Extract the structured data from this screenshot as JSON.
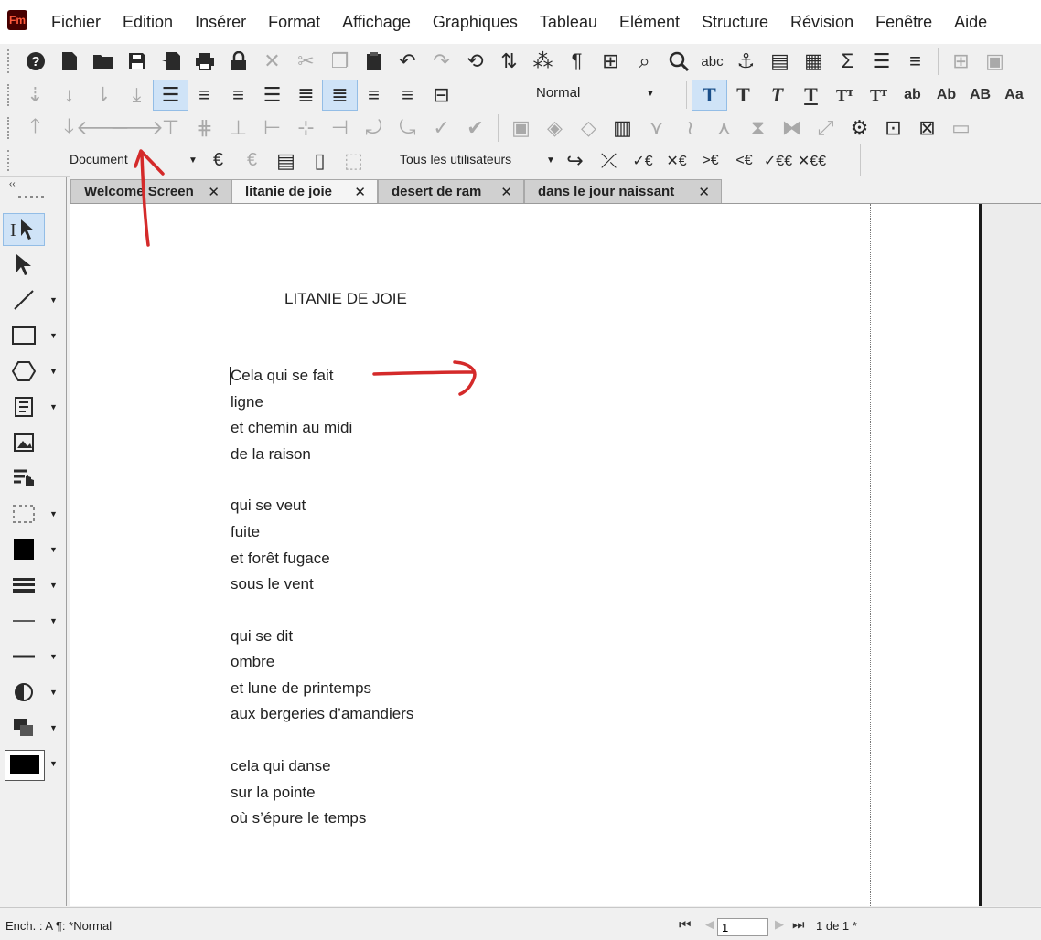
{
  "app": {
    "logo_text": "Fm"
  },
  "menu": [
    "Fichier",
    "Edition",
    "Insérer",
    "Format",
    "Affichage",
    "Graphiques",
    "Tableau",
    "Elément",
    "Structure",
    "Révision",
    "Fenêtre",
    "Aide"
  ],
  "toolbar": {
    "paragraph_style": "Normal",
    "text_styles": [
      "T",
      "T",
      "T",
      "T",
      "Tᵀ",
      "Tᵀ",
      "ab",
      "Ab",
      "AB",
      "Aa"
    ],
    "doc_scope": "Document",
    "user_filter": "Tous les utilisateurs"
  },
  "tabs": [
    {
      "label": "Welcome Screen",
      "close": "✕"
    },
    {
      "label": "litanie de joie",
      "close": "✕"
    },
    {
      "label": "desert de ram",
      "close": "✕"
    },
    {
      "label": "dans le jour naissant",
      "close": "✕"
    }
  ],
  "document": {
    "title": "LITANIE DE JOIE",
    "lines": [
      "Cela qui se fait",
      "ligne",
      "et chemin au midi",
      "de la raison",
      "qui se veut",
      "fuite",
      "et forêt fugace",
      "sous le vent",
      "qui se dit",
      "ombre",
      "et lune de printemps",
      "aux bergeries d’amandiers",
      "cela qui danse",
      "sur la pointe",
      "où s’épure le temps"
    ]
  },
  "status": {
    "text": "Ench. : A  ¶: *Normal",
    "page_value": "1",
    "page_count": "1 de 1 *"
  },
  "colors": {
    "annotation": "#d42a2a",
    "selection": "#cfe3f7"
  }
}
